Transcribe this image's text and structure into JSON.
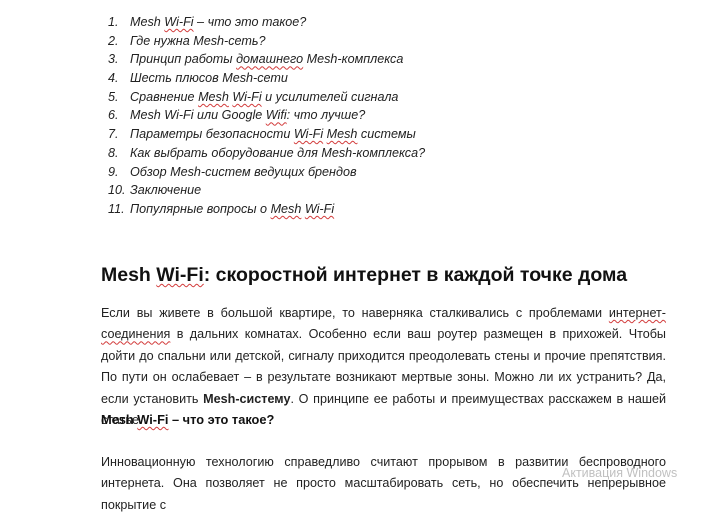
{
  "toc": {
    "items": [
      {
        "num": "1.",
        "parts": [
          [
            "Mesh",
            0
          ],
          [
            " ",
            0
          ],
          [
            "Wi-Fi",
            1
          ],
          [
            " – что это такое?",
            0
          ]
        ]
      },
      {
        "num": "2.",
        "parts": [
          [
            "Где нужна Mesh-сеть?",
            0
          ]
        ]
      },
      {
        "num": "3.",
        "parts": [
          [
            "Принцип работы ",
            0
          ],
          [
            "домашнего",
            1
          ],
          [
            " Mesh-комплекса",
            0
          ]
        ]
      },
      {
        "num": "4.",
        "parts": [
          [
            "Шесть плюсов Mesh-сети",
            0
          ]
        ]
      },
      {
        "num": "5.",
        "parts": [
          [
            "Сравнение ",
            0
          ],
          [
            "Mesh",
            1
          ],
          [
            " ",
            0
          ],
          [
            "Wi-Fi",
            1
          ],
          [
            " и усилителей сигнала",
            0
          ]
        ]
      },
      {
        "num": "6.",
        "parts": [
          [
            "Mesh Wi-Fi или Google ",
            0
          ],
          [
            "Wifi",
            1
          ],
          [
            ": что лучше?",
            0
          ]
        ]
      },
      {
        "num": "7.",
        "parts": [
          [
            "Параметры безопасности ",
            0
          ],
          [
            "Wi-Fi",
            1
          ],
          [
            " ",
            0
          ],
          [
            "Mesh",
            1
          ],
          [
            " системы",
            0
          ]
        ]
      },
      {
        "num": "8.",
        "parts": [
          [
            "Как выбрать оборудование для Mesh-комплекса?",
            0
          ]
        ]
      },
      {
        "num": "9.",
        "parts": [
          [
            "Обзор Mesh-систем ведущих брендов",
            0
          ]
        ]
      },
      {
        "num": "10.",
        "parts": [
          [
            "Заключение",
            0
          ]
        ]
      },
      {
        "num": "11.",
        "parts": [
          [
            "Популярные вопросы о ",
            0
          ],
          [
            "Mesh",
            1
          ],
          [
            " ",
            0
          ],
          [
            "Wi-Fi",
            1
          ]
        ]
      }
    ]
  },
  "article": {
    "heading_parts": [
      [
        "Mesh",
        0
      ],
      [
        " ",
        0
      ],
      [
        "Wi-Fi",
        1
      ],
      [
        ": скоростной интернет в каждой точке дома",
        0
      ]
    ],
    "intro_parts": [
      [
        "Если вы живете в большой квартире, то наверняка сталкивались с проблемами ",
        0
      ],
      [
        "интернет-соединения",
        1
      ],
      [
        " в дальних комнатах. Особенно если ваш роутер размещен в прихожей. Чтобы дойти до спальни или детской, сигналу приходится преодолевать стены и прочие препятствия. По пути он ослабевает – в результате возникают мертвые зоны. Можно ли их устранить? Да, если установить ",
        0
      ],
      [
        "Mesh-систему",
        2
      ],
      [
        ". О принципе ее работы и преимуществах расскажем в нашей статье.",
        0
      ]
    ],
    "subheading_parts": [
      [
        "Mesh",
        0
      ],
      [
        " ",
        0
      ],
      [
        "Wi-Fi",
        1
      ],
      [
        " – что это такое?",
        0
      ]
    ],
    "para2_parts": [
      [
        "Инновационную технологию справедливо считают прорывом в развитии беспроводного интернета. Она позволяет не просто масштабировать сеть, но обеспечить непрерывное покрытие с",
        0
      ]
    ]
  },
  "watermark": "Активация Windows"
}
